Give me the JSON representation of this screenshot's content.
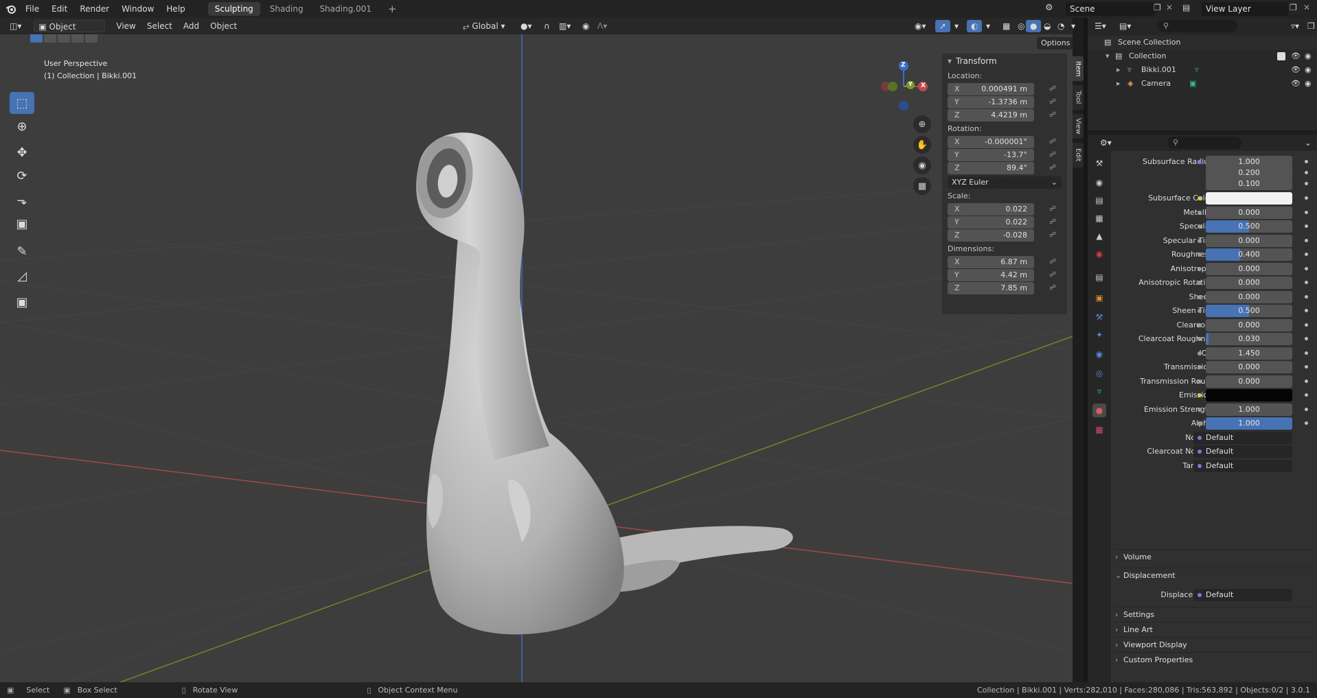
{
  "topbar": {
    "menus": [
      "File",
      "Edit",
      "Render",
      "Window",
      "Help"
    ],
    "workspaces": [
      {
        "label": "Sculpting",
        "active": true
      },
      {
        "label": "Shading",
        "active": false
      },
      {
        "label": "Shading.001",
        "active": false
      }
    ],
    "add_tab_glyph": "+",
    "scene": "Scene",
    "view_layer": "View Layer"
  },
  "viewport_header": {
    "mode": "Object Mode",
    "menus": [
      "View",
      "Select",
      "Add",
      "Object"
    ],
    "orientation": "Global",
    "options_label": "Options"
  },
  "viewport": {
    "perspective": "User Perspective",
    "collection_info": "(1) Collection | Bikki.001",
    "background_color": "#3d3d3d",
    "x_axis_color": "#b04545",
    "y_axis_color": "#6e8c2e",
    "z_axis_color": "#3a6dc8",
    "gizmo": {
      "x": "X",
      "y": "Y",
      "z": "Z"
    }
  },
  "tools": [
    "select-box-icon",
    "cursor-icon",
    "move-icon",
    "rotate-icon",
    "scale-icon",
    "transform-icon",
    "annotate-icon",
    "measure-icon",
    "add-cube-icon"
  ],
  "npanel": {
    "title": "Transform",
    "location_label": "Location:",
    "location": [
      {
        "axis": "X",
        "value": "0.000491 m"
      },
      {
        "axis": "Y",
        "value": "-1.3736 m"
      },
      {
        "axis": "Z",
        "value": "4.4219 m"
      }
    ],
    "rotation_label": "Rotation:",
    "rotation": [
      {
        "axis": "X",
        "value": "-0.000001°"
      },
      {
        "axis": "Y",
        "value": "-13.7°"
      },
      {
        "axis": "Z",
        "value": "89.4°"
      }
    ],
    "rotation_mode": "XYZ Euler",
    "scale_label": "Scale:",
    "scale": [
      {
        "axis": "X",
        "value": "0.022"
      },
      {
        "axis": "Y",
        "value": "0.022"
      },
      {
        "axis": "Z",
        "value": "-0.028"
      }
    ],
    "dimensions_label": "Dimensions:",
    "dimensions": [
      {
        "axis": "X",
        "value": "6.87 m"
      },
      {
        "axis": "Y",
        "value": "4.42 m"
      },
      {
        "axis": "Z",
        "value": "7.85 m"
      }
    ],
    "tabs": [
      "Item",
      "Tool",
      "View",
      "Edit"
    ]
  },
  "outliner": {
    "root": "Scene Collection",
    "collection": "Collection",
    "items": [
      "Bikki.001",
      "Camera"
    ]
  },
  "properties": {
    "rows": [
      {
        "label": "Subsurface Radius",
        "value": "1.000",
        "dot": "blue",
        "fill": 0
      },
      {
        "label": "",
        "value": "0.200",
        "dot": "none",
        "fill": 0
      },
      {
        "label": "",
        "value": "0.100",
        "dot": "none",
        "fill": 0
      },
      {
        "label": "Subsurface Color",
        "value": "",
        "dot": "yellow",
        "color": "#f2f2f2",
        "fill": 0
      },
      {
        "label": "Metallic",
        "value": "0.000",
        "dot": "grey",
        "fill": 0
      },
      {
        "label": "Specular",
        "value": "0.500",
        "dot": "grey",
        "fill": 0.5
      },
      {
        "label": "Specular Tint",
        "value": "0.000",
        "dot": "grey",
        "fill": 0
      },
      {
        "label": "Roughness",
        "value": "0.400",
        "dot": "grey",
        "fill": 0.4
      },
      {
        "label": "Anisotropic",
        "value": "0.000",
        "dot": "grey",
        "fill": 0
      },
      {
        "label": "Anisotropic Rotati...",
        "value": "0.000",
        "dot": "grey",
        "fill": 0
      },
      {
        "label": "Sheen",
        "value": "0.000",
        "dot": "grey",
        "fill": 0
      },
      {
        "label": "Sheen Tint",
        "value": "0.500",
        "dot": "grey",
        "fill": 0.5
      },
      {
        "label": "Clearcoat",
        "value": "0.000",
        "dot": "grey",
        "fill": 0
      },
      {
        "label": "Clearcoat Roughn...",
        "value": "0.030",
        "dot": "grey",
        "fill": 0.03
      },
      {
        "label": "IOR",
        "value": "1.450",
        "dot": "grey",
        "fill": 0
      },
      {
        "label": "Transmission",
        "value": "0.000",
        "dot": "grey",
        "fill": 0
      },
      {
        "label": "Transmission Rou...",
        "value": "0.000",
        "dot": "grey",
        "fill": 0
      },
      {
        "label": "Emission",
        "value": "",
        "dot": "yellow",
        "color": "#050505",
        "fill": 0
      },
      {
        "label": "Emission Strength",
        "value": "1.000",
        "dot": "grey",
        "fill": 0
      },
      {
        "label": "Alpha",
        "value": "1.000",
        "dot": "grey",
        "fill": 1
      },
      {
        "label": "Normal",
        "value": "Default",
        "dot": "socket",
        "fill": 0
      },
      {
        "label": "Clearcoat Normal",
        "value": "Default",
        "dot": "socket",
        "fill": 0
      },
      {
        "label": "Tangent",
        "value": "Default",
        "dot": "socket",
        "fill": 0
      }
    ],
    "sections": [
      {
        "label": "Volume",
        "open": false
      },
      {
        "label": "Displacement",
        "open": true
      }
    ],
    "displacement_row": {
      "label": "Displacement",
      "value": "Default"
    },
    "closed_sections": [
      "Settings",
      "Line Art",
      "Viewport Display",
      "Custom Properties"
    ]
  },
  "statusbar": {
    "left": [
      {
        "key": "Select"
      },
      {
        "key": "Box Select"
      },
      {
        "key": "Rotate View"
      },
      {
        "key": "Object Context Menu"
      }
    ],
    "right": "Collection | Bikki.001 | Verts:282,010 | Faces:280,086 | Tris:563,892 | Objects:0/2 | 3.0.1"
  }
}
